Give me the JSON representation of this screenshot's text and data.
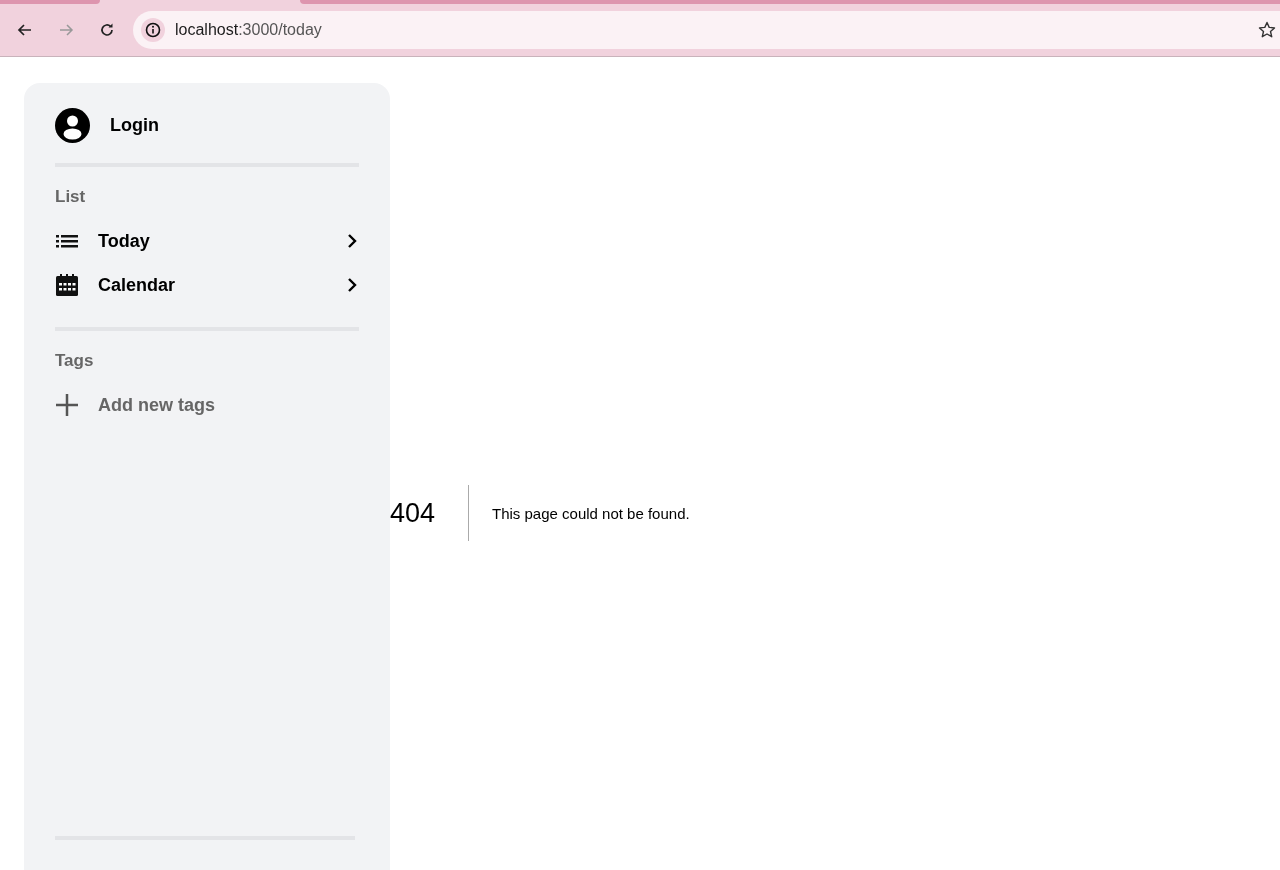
{
  "browser": {
    "url_host": "localhost",
    "url_path": ":3000/today"
  },
  "sidebar": {
    "account": {
      "label": "Login"
    },
    "sections": [
      {
        "title": "List",
        "items": [
          {
            "kind": "link",
            "label": "Today"
          },
          {
            "kind": "link",
            "label": "Calendar"
          }
        ]
      },
      {
        "title": "Tags",
        "items": [
          {
            "kind": "action",
            "label": "Add new tags"
          }
        ]
      }
    ]
  },
  "error": {
    "code": "404",
    "message": "This page could not be found."
  }
}
